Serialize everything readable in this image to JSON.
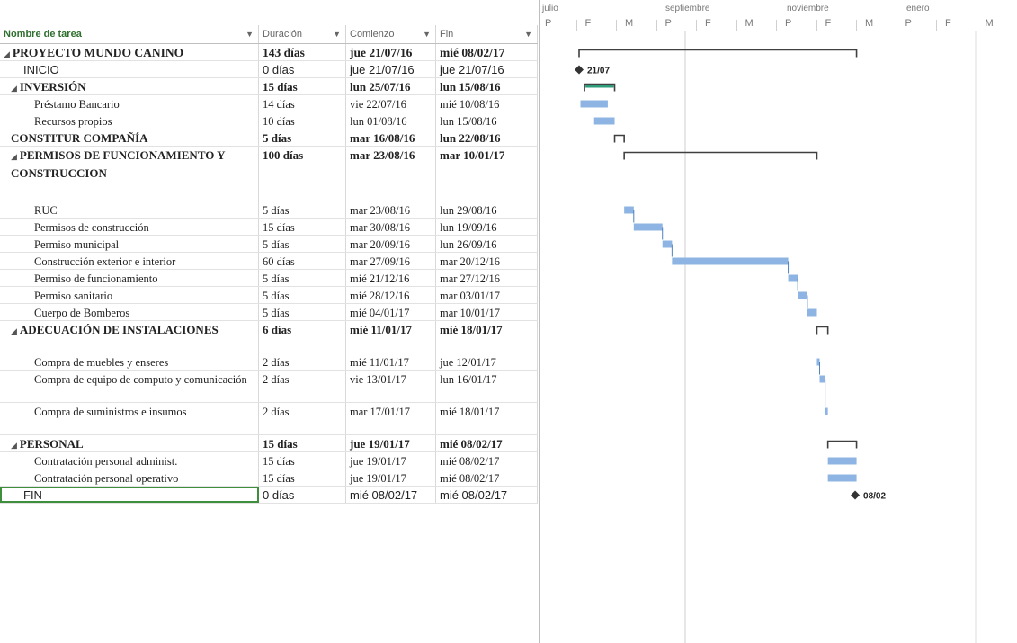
{
  "columns": {
    "name": "Nombre de tarea",
    "duration": "Duración",
    "start": "Comienzo",
    "finish": "Fin"
  },
  "tasks": [
    {
      "name": "PROYECTO MUNDO CANINO",
      "duration": "143 días",
      "start": "jue 21/07/16",
      "finish": "mié 08/02/17",
      "summary": true,
      "collapse": "◢"
    },
    {
      "name": "INICIO",
      "duration": "0 días",
      "start": "jue 21/07/16",
      "finish": "jue 21/07/16",
      "milestone": true
    },
    {
      "name": "INVERSIÓN",
      "duration": "15 días",
      "start": "lun 25/07/16",
      "finish": "lun 15/08/16",
      "summary": true,
      "collapse": "◢"
    },
    {
      "name": "Préstamo Bancario",
      "duration": "14 días",
      "start": "vie 22/07/16",
      "finish": "mié 10/08/16"
    },
    {
      "name": "Recursos propios",
      "duration": "10 días",
      "start": "lun 01/08/16",
      "finish": "lun 15/08/16"
    },
    {
      "name": "CONSTITUR COMPAÑÍA",
      "duration": "5 días",
      "start": "mar 16/08/16",
      "finish": "lun 22/08/16",
      "summary": true
    },
    {
      "name": "PERMISOS DE FUNCIONAMIENTO Y CONSTRUCCION",
      "duration": "100 días",
      "start": "mar 23/08/16",
      "finish": "mar 10/01/17",
      "summary": true,
      "collapse": "◢"
    },
    {
      "name": "RUC",
      "duration": "5 días",
      "start": "mar 23/08/16",
      "finish": "lun 29/08/16"
    },
    {
      "name": "Permisos de construcción",
      "duration": "15 días",
      "start": "mar 30/08/16",
      "finish": "lun 19/09/16"
    },
    {
      "name": "Permiso municipal",
      "duration": "5 días",
      "start": "mar 20/09/16",
      "finish": "lun 26/09/16"
    },
    {
      "name": "Construcción exterior e interior",
      "duration": "60 días",
      "start": "mar 27/09/16",
      "finish": "mar 20/12/16"
    },
    {
      "name": "Permiso de funcionamiento",
      "duration": "5 días",
      "start": "mié 21/12/16",
      "finish": "mar 27/12/16"
    },
    {
      "name": "Permiso sanitario",
      "duration": "5 días",
      "start": "mié 28/12/16",
      "finish": "mar 03/01/17"
    },
    {
      "name": "Cuerpo de Bomberos",
      "duration": "5 días",
      "start": "mié 04/01/17",
      "finish": "mar 10/01/17"
    },
    {
      "name": "ADECUACIÓN DE INSTALACIONES",
      "duration": "6 días",
      "start": "mié 11/01/17",
      "finish": "mié 18/01/17",
      "summary": true,
      "collapse": "◢"
    },
    {
      "name": "Compra de muebles y enseres",
      "duration": "2 días",
      "start": "mié 11/01/17",
      "finish": "jue 12/01/17"
    },
    {
      "name": "Compra de equipo de computo y comunicación",
      "duration": "2 días",
      "start": "vie 13/01/17",
      "finish": "lun 16/01/17"
    },
    {
      "name": "Compra de suministros e insumos",
      "duration": "2 días",
      "start": "mar 17/01/17",
      "finish": "mié 18/01/17"
    },
    {
      "name": "PERSONAL",
      "duration": "15 días",
      "start": "jue 19/01/17",
      "finish": "mié 08/02/17",
      "summary": true,
      "collapse": "◢"
    },
    {
      "name": "Contratación personal administ.",
      "duration": "15 días",
      "start": "jue 19/01/17",
      "finish": "mié 08/02/17"
    },
    {
      "name": "Contratación personal operativo",
      "duration": "15 días",
      "start": "jue 19/01/17",
      "finish": "mié 08/02/17"
    },
    {
      "name": "FIN",
      "duration": "0 días",
      "start": "mié 08/02/17",
      "finish": "mié 08/02/17",
      "milestone": true
    }
  ],
  "timeline": {
    "months": [
      "julio",
      "septiembre",
      "noviembre",
      "enero"
    ],
    "subcols": [
      "P",
      "F",
      "M",
      "P",
      "F",
      "M",
      "P",
      "F",
      "M",
      "P",
      "F",
      "M"
    ]
  },
  "milestone_labels": {
    "start": "21/07",
    "end": "08/02"
  },
  "colors": {
    "bar": "#8db4e2",
    "summary": "#404040",
    "critical": "#2e9c7a",
    "selection": "#3e8e3e"
  }
}
